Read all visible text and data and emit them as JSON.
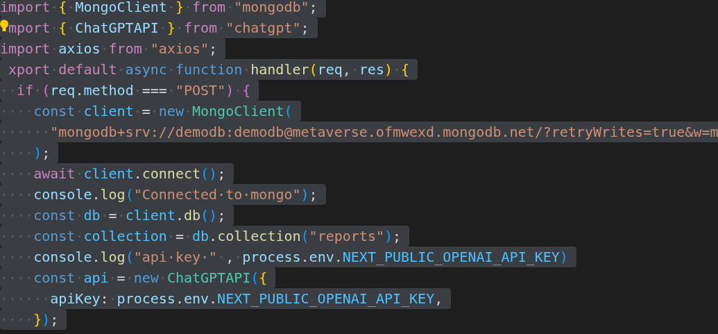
{
  "editor": {
    "lines": [
      {
        "selected": true,
        "tokens": [
          {
            "text": "import",
            "kind": "keyword"
          },
          {
            "text": "·",
            "kind": "space"
          },
          {
            "text": "{",
            "kind": "brace1"
          },
          {
            "text": "·",
            "kind": "space"
          },
          {
            "text": "MongoClient",
            "kind": "variable"
          },
          {
            "text": "·",
            "kind": "space"
          },
          {
            "text": "}",
            "kind": "brace1"
          },
          {
            "text": "·",
            "kind": "space"
          },
          {
            "text": "from",
            "kind": "keyword"
          },
          {
            "text": "·",
            "kind": "space"
          },
          {
            "text": "\"mongodb\"",
            "kind": "string"
          },
          {
            "text": ";",
            "kind": "punct"
          }
        ]
      },
      {
        "selected": true,
        "lightbulb": true,
        "tokens": [
          {
            "text": "mport",
            "kind": "keyword"
          },
          {
            "text": "·",
            "kind": "space"
          },
          {
            "text": "{",
            "kind": "brace1"
          },
          {
            "text": "·",
            "kind": "space"
          },
          {
            "text": "ChatGPTAPI",
            "kind": "variable"
          },
          {
            "text": "·",
            "kind": "space"
          },
          {
            "text": "}",
            "kind": "brace1"
          },
          {
            "text": "·",
            "kind": "space"
          },
          {
            "text": "from",
            "kind": "keyword"
          },
          {
            "text": "·",
            "kind": "space"
          },
          {
            "text": "\"chatgpt\"",
            "kind": "string"
          },
          {
            "text": ";",
            "kind": "punct"
          }
        ]
      },
      {
        "selected": true,
        "tokens": [
          {
            "text": "import",
            "kind": "keyword"
          },
          {
            "text": "·",
            "kind": "space"
          },
          {
            "text": "axios",
            "kind": "variable"
          },
          {
            "text": "·",
            "kind": "space"
          },
          {
            "text": "from",
            "kind": "keyword"
          },
          {
            "text": "·",
            "kind": "space"
          },
          {
            "text": "\"axios\"",
            "kind": "string"
          },
          {
            "text": ";",
            "kind": "punct"
          }
        ]
      },
      {
        "selected": true,
        "lead_gap": true,
        "tokens": [
          {
            "text": "xport",
            "kind": "keyword"
          },
          {
            "text": "·",
            "kind": "space"
          },
          {
            "text": "default",
            "kind": "keyword"
          },
          {
            "text": "·",
            "kind": "space"
          },
          {
            "text": "async",
            "kind": "storage"
          },
          {
            "text": "·",
            "kind": "space"
          },
          {
            "text": "function",
            "kind": "storage"
          },
          {
            "text": "·",
            "kind": "space"
          },
          {
            "text": "handler",
            "kind": "function"
          },
          {
            "text": "(",
            "kind": "brace1"
          },
          {
            "text": "req",
            "kind": "variable"
          },
          {
            "text": ",",
            "kind": "punct"
          },
          {
            "text": "·",
            "kind": "space"
          },
          {
            "text": "res",
            "kind": "variable"
          },
          {
            "text": ")",
            "kind": "brace1"
          },
          {
            "text": "·",
            "kind": "space"
          },
          {
            "text": "{",
            "kind": "brace1"
          }
        ]
      },
      {
        "selected": true,
        "tokens": [
          {
            "text": "··",
            "kind": "space"
          },
          {
            "text": "if",
            "kind": "keyword"
          },
          {
            "text": "·",
            "kind": "space"
          },
          {
            "text": "(",
            "kind": "brace2"
          },
          {
            "text": "req",
            "kind": "variable"
          },
          {
            "text": ".",
            "kind": "punct"
          },
          {
            "text": "method",
            "kind": "variable"
          },
          {
            "text": "·",
            "kind": "space"
          },
          {
            "text": "===",
            "kind": "punct"
          },
          {
            "text": "·",
            "kind": "space"
          },
          {
            "text": "\"POST\"",
            "kind": "string"
          },
          {
            "text": ")",
            "kind": "brace2"
          },
          {
            "text": "·",
            "kind": "space"
          },
          {
            "text": "{",
            "kind": "brace2"
          }
        ]
      },
      {
        "selected": true,
        "tokens": [
          {
            "text": "····",
            "kind": "space"
          },
          {
            "text": "const",
            "kind": "storage"
          },
          {
            "text": "·",
            "kind": "space"
          },
          {
            "text": "client",
            "kind": "constant"
          },
          {
            "text": "·",
            "kind": "space"
          },
          {
            "text": "=",
            "kind": "punct"
          },
          {
            "text": "·",
            "kind": "space"
          },
          {
            "text": "new",
            "kind": "storage"
          },
          {
            "text": "·",
            "kind": "space"
          },
          {
            "text": "MongoClient",
            "kind": "class"
          },
          {
            "text": "(",
            "kind": "brace3"
          }
        ]
      },
      {
        "selected": true,
        "tokens": [
          {
            "text": "······",
            "kind": "space"
          },
          {
            "text": "\"mongodb+srv://demodb:demodb@metaverse.ofmwexd.mongodb.net/?retryWrites=true&w=m",
            "kind": "string"
          }
        ]
      },
      {
        "selected": true,
        "tokens": [
          {
            "text": "····",
            "kind": "space"
          },
          {
            "text": ")",
            "kind": "brace3"
          },
          {
            "text": ";",
            "kind": "punct"
          }
        ]
      },
      {
        "selected": true,
        "tokens": [
          {
            "text": "····",
            "kind": "space"
          },
          {
            "text": "await",
            "kind": "keyword"
          },
          {
            "text": "·",
            "kind": "space"
          },
          {
            "text": "client",
            "kind": "constant"
          },
          {
            "text": ".",
            "kind": "punct"
          },
          {
            "text": "connect",
            "kind": "function"
          },
          {
            "text": "()",
            "kind": "brace3"
          },
          {
            "text": ";",
            "kind": "punct"
          }
        ]
      },
      {
        "selected": true,
        "tokens": [
          {
            "text": "····",
            "kind": "space"
          },
          {
            "text": "console",
            "kind": "variable"
          },
          {
            "text": ".",
            "kind": "punct"
          },
          {
            "text": "log",
            "kind": "function"
          },
          {
            "text": "(",
            "kind": "brace3"
          },
          {
            "text": "\"Connected·to·mongo\"",
            "kind": "string"
          },
          {
            "text": ")",
            "kind": "brace3"
          },
          {
            "text": ";",
            "kind": "punct"
          }
        ]
      },
      {
        "selected": true,
        "tokens": [
          {
            "text": "····",
            "kind": "space"
          },
          {
            "text": "const",
            "kind": "storage"
          },
          {
            "text": "·",
            "kind": "space"
          },
          {
            "text": "db",
            "kind": "constant"
          },
          {
            "text": "·",
            "kind": "space"
          },
          {
            "text": "=",
            "kind": "punct"
          },
          {
            "text": "·",
            "kind": "space"
          },
          {
            "text": "client",
            "kind": "constant"
          },
          {
            "text": ".",
            "kind": "punct"
          },
          {
            "text": "db",
            "kind": "function"
          },
          {
            "text": "()",
            "kind": "brace3"
          },
          {
            "text": ";",
            "kind": "punct"
          }
        ]
      },
      {
        "selected": true,
        "tokens": [
          {
            "text": "····",
            "kind": "space"
          },
          {
            "text": "const",
            "kind": "storage"
          },
          {
            "text": "·",
            "kind": "space"
          },
          {
            "text": "collection",
            "kind": "constant"
          },
          {
            "text": "·",
            "kind": "space"
          },
          {
            "text": "=",
            "kind": "punct"
          },
          {
            "text": "·",
            "kind": "space"
          },
          {
            "text": "db",
            "kind": "constant"
          },
          {
            "text": ".",
            "kind": "punct"
          },
          {
            "text": "collection",
            "kind": "function"
          },
          {
            "text": "(",
            "kind": "brace3"
          },
          {
            "text": "\"reports\"",
            "kind": "string"
          },
          {
            "text": ")",
            "kind": "brace3"
          },
          {
            "text": ";",
            "kind": "punct"
          }
        ]
      },
      {
        "selected": true,
        "tokens": [
          {
            "text": "····",
            "kind": "space"
          },
          {
            "text": "console",
            "kind": "variable"
          },
          {
            "text": ".",
            "kind": "punct"
          },
          {
            "text": "log",
            "kind": "function"
          },
          {
            "text": "(",
            "kind": "brace3"
          },
          {
            "text": "\"api·key·\"",
            "kind": "string"
          },
          {
            "text": "·",
            "kind": "space"
          },
          {
            "text": ",",
            "kind": "punct"
          },
          {
            "text": "·",
            "kind": "space"
          },
          {
            "text": "process",
            "kind": "variable"
          },
          {
            "text": ".",
            "kind": "punct"
          },
          {
            "text": "env",
            "kind": "variable"
          },
          {
            "text": ".",
            "kind": "punct"
          },
          {
            "text": "NEXT_PUBLIC_OPENAI_API_KEY",
            "kind": "constant"
          },
          {
            "text": ")",
            "kind": "brace3"
          }
        ]
      },
      {
        "selected": true,
        "tokens": [
          {
            "text": "····",
            "kind": "space"
          },
          {
            "text": "const",
            "kind": "storage"
          },
          {
            "text": "·",
            "kind": "space"
          },
          {
            "text": "api",
            "kind": "constant"
          },
          {
            "text": "·",
            "kind": "space"
          },
          {
            "text": "=",
            "kind": "punct"
          },
          {
            "text": "·",
            "kind": "space"
          },
          {
            "text": "new",
            "kind": "storage"
          },
          {
            "text": "·",
            "kind": "space"
          },
          {
            "text": "ChatGPTAPI",
            "kind": "class"
          },
          {
            "text": "(",
            "kind": "brace3"
          },
          {
            "text": "{",
            "kind": "brace1"
          }
        ]
      },
      {
        "selected": true,
        "tokens": [
          {
            "text": "······",
            "kind": "space"
          },
          {
            "text": "apiKey",
            "kind": "variable"
          },
          {
            "text": ":",
            "kind": "punct"
          },
          {
            "text": "·",
            "kind": "space"
          },
          {
            "text": "process",
            "kind": "variable"
          },
          {
            "text": ".",
            "kind": "punct"
          },
          {
            "text": "env",
            "kind": "variable"
          },
          {
            "text": ".",
            "kind": "punct"
          },
          {
            "text": "NEXT_PUBLIC_OPENAI_API_KEY",
            "kind": "constant"
          },
          {
            "text": ",",
            "kind": "punct"
          }
        ]
      },
      {
        "selected": true,
        "tokens": [
          {
            "text": "····",
            "kind": "space"
          },
          {
            "text": "}",
            "kind": "brace1"
          },
          {
            "text": ")",
            "kind": "brace3"
          },
          {
            "text": ";",
            "kind": "punct"
          }
        ]
      }
    ]
  }
}
